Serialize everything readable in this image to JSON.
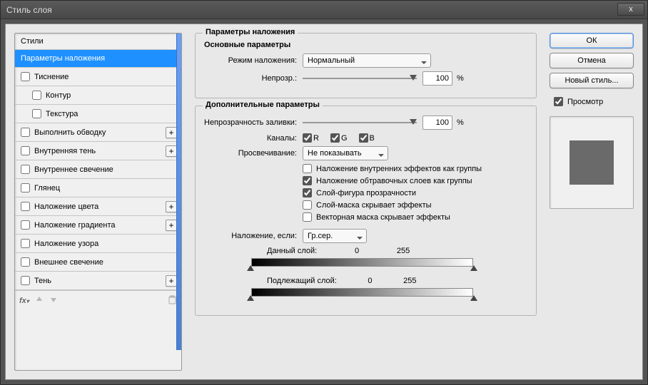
{
  "titlebar": {
    "title": "Стиль слоя",
    "close": "x"
  },
  "styles": {
    "header": "Стили",
    "items": [
      {
        "label": "Параметры наложения",
        "selected": true
      },
      {
        "label": "Тиснение",
        "check": true
      },
      {
        "label": "Контур",
        "check": true,
        "sub": true
      },
      {
        "label": "Текстура",
        "check": true,
        "sub": true
      },
      {
        "label": "Выполнить обводку",
        "check": true,
        "plus": true
      },
      {
        "label": "Внутренняя тень",
        "check": true,
        "plus": true
      },
      {
        "label": "Внутреннее свечение",
        "check": true
      },
      {
        "label": "Глянец",
        "check": true
      },
      {
        "label": "Наложение цвета",
        "check": true,
        "plus": true
      },
      {
        "label": "Наложение градиента",
        "check": true,
        "plus": true
      },
      {
        "label": "Наложение узора",
        "check": true
      },
      {
        "label": "Внешнее свечение",
        "check": true
      },
      {
        "label": "Тень",
        "check": true,
        "plus": true
      }
    ],
    "footer_fx": "fx"
  },
  "main": {
    "section_title": "Параметры наложения",
    "basic_title": "Основные параметры",
    "blend_mode_label": "Режим наложения:",
    "blend_mode_value": "Нормальный",
    "opacity_label": "Непрозр.:",
    "opacity_value": "100",
    "pct": "%",
    "adv_title": "Дополнительные параметры",
    "fill_opacity_label": "Непрозрачность заливки:",
    "fill_opacity_value": "100",
    "channels_label": "Каналы:",
    "ch_r": "R",
    "ch_g": "G",
    "ch_b": "B",
    "knockout_label": "Просвечивание:",
    "knockout_value": "Не показывать",
    "cb1": "Наложение внутренних эффектов как группы",
    "cb2": "Наложение обтравочных слоев как группы",
    "cb3": "Слой-фигура прозрачности",
    "cb4": "Слой-маска скрывает эффекты",
    "cb5": "Векторная маска скрывает эффекты",
    "blendif_label": "Наложение, если:",
    "blendif_value": "Гр.сер.",
    "this_layer": "Данный слой:",
    "this_lo": "0",
    "this_hi": "255",
    "under_layer": "Подлежащий слой:",
    "under_lo": "0",
    "under_hi": "255"
  },
  "right": {
    "ok": "ОК",
    "cancel": "Отмена",
    "newstyle": "Новый стиль...",
    "preview": "Просмотр"
  }
}
